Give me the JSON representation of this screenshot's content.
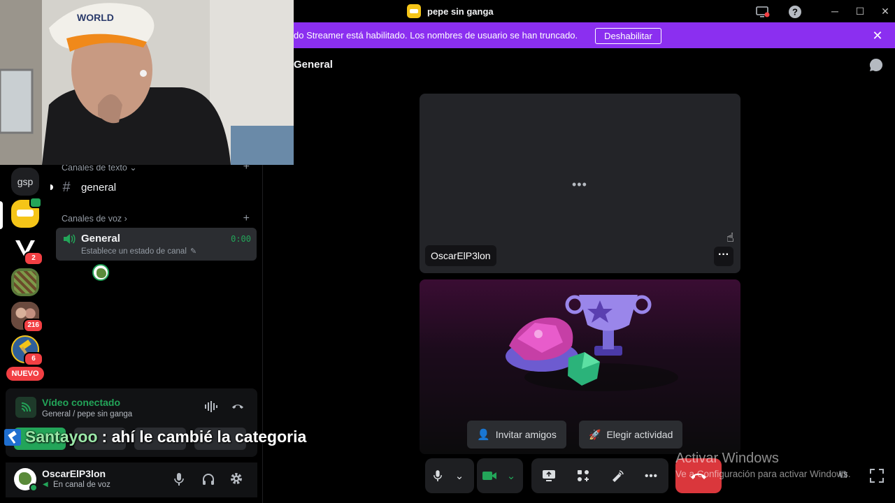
{
  "window": {
    "title": "pepe sin ganga",
    "controls": {
      "minimize": "─",
      "maximize": "☐",
      "close": "✕"
    }
  },
  "banner": {
    "text": "do Streamer está habilitado. Los nombres de usuario se han truncado.",
    "button_label": "Deshabilitar",
    "close": "✕",
    "color": "#8b2ff0"
  },
  "rail": {
    "server_label": "gsp",
    "badges": [
      "2",
      "216",
      "6"
    ],
    "new_label": "NUEVO"
  },
  "sidebar": {
    "text_category": "Canales de texto",
    "text_channel": "general",
    "voice_category": "Canales de voz",
    "voice_channel": "General",
    "voice_timer": "0:00",
    "voice_status": "Establece un estado de canal"
  },
  "voice_panel": {
    "status": "Vídeo conectado",
    "location": "General / pepe sin ganga"
  },
  "user_panel": {
    "username": "OscarElP3lon",
    "status": "En canal de voz"
  },
  "main": {
    "channel_title": "General",
    "tile_user": "OscarElP3lon",
    "more": "···",
    "invite_label": "Invitar amigos",
    "activity_label": "Elegir actividad"
  },
  "overlay": {
    "chat_user": "Santayoo",
    "chat_message": ": ahí le cambié la categoria",
    "activate_title": "Activar Windows",
    "activate_sub": "Ve a Configuración para activar Windows."
  },
  "colors": {
    "accent_green": "#23a559",
    "danger": "#da373c",
    "brand_yellow": "#f5c518"
  }
}
